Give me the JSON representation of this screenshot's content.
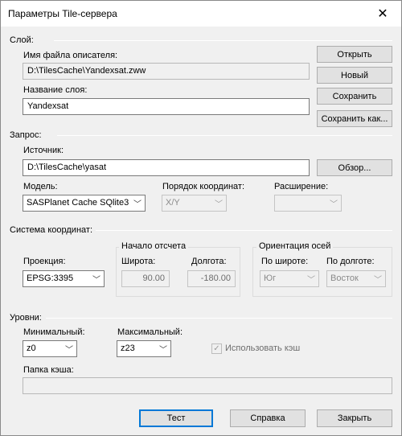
{
  "window": {
    "title": "Параметры Tile-сервера",
    "close_glyph": "✕"
  },
  "layer": {
    "section_label": "Слой:",
    "descriptor_label": "Имя файла описателя:",
    "descriptor_value": "D:\\TilesCache\\Yandexsat.zww",
    "name_label": "Название слоя:",
    "name_value": "Yandexsat",
    "open_button": "Открыть",
    "new_button": "Новый",
    "save_button": "Сохранить",
    "save_as_button": "Сохранить как..."
  },
  "request": {
    "section_label": "Запрос:",
    "source_label": "Источник:",
    "source_value": "D:\\TilesCache\\yasat",
    "browse_button": "Обзор...",
    "model_label": "Модель:",
    "model_value": "SASPlanet Cache SQlite3",
    "order_label": "Порядок координат:",
    "order_value": "X/Y",
    "extension_label": "Расширение:",
    "extension_value": ""
  },
  "coords": {
    "section_label": "Система координат:",
    "projection_label": "Проекция:",
    "projection_value": "EPSG:3395",
    "origin_group": "Начало отсчета",
    "lat_label": "Широта:",
    "lat_value": "90.00",
    "lon_label": "Долгота:",
    "lon_value": "-180.00",
    "axes_group": "Ориентация осей",
    "by_lat_label": "По широте:",
    "by_lat_value": "Юг",
    "by_lon_label": "По долготе:",
    "by_lon_value": "Восток"
  },
  "levels": {
    "section_label": "Уровни:",
    "min_label": "Минимальный:",
    "min_value": "z0",
    "max_label": "Максимальный:",
    "max_value": "z23",
    "use_cache_label": "Использовать кэш",
    "use_cache_checked": true,
    "cache_folder_label": "Папка кэша:",
    "cache_folder_value": ""
  },
  "footer": {
    "test_button": "Тест",
    "help_button": "Справка",
    "close_button": "Закрыть"
  },
  "icons": {
    "dropdown": "﹀",
    "check": "✓"
  },
  "colors": {
    "accent": "#0078d7",
    "dialog_bg": "#f0f0f0"
  }
}
